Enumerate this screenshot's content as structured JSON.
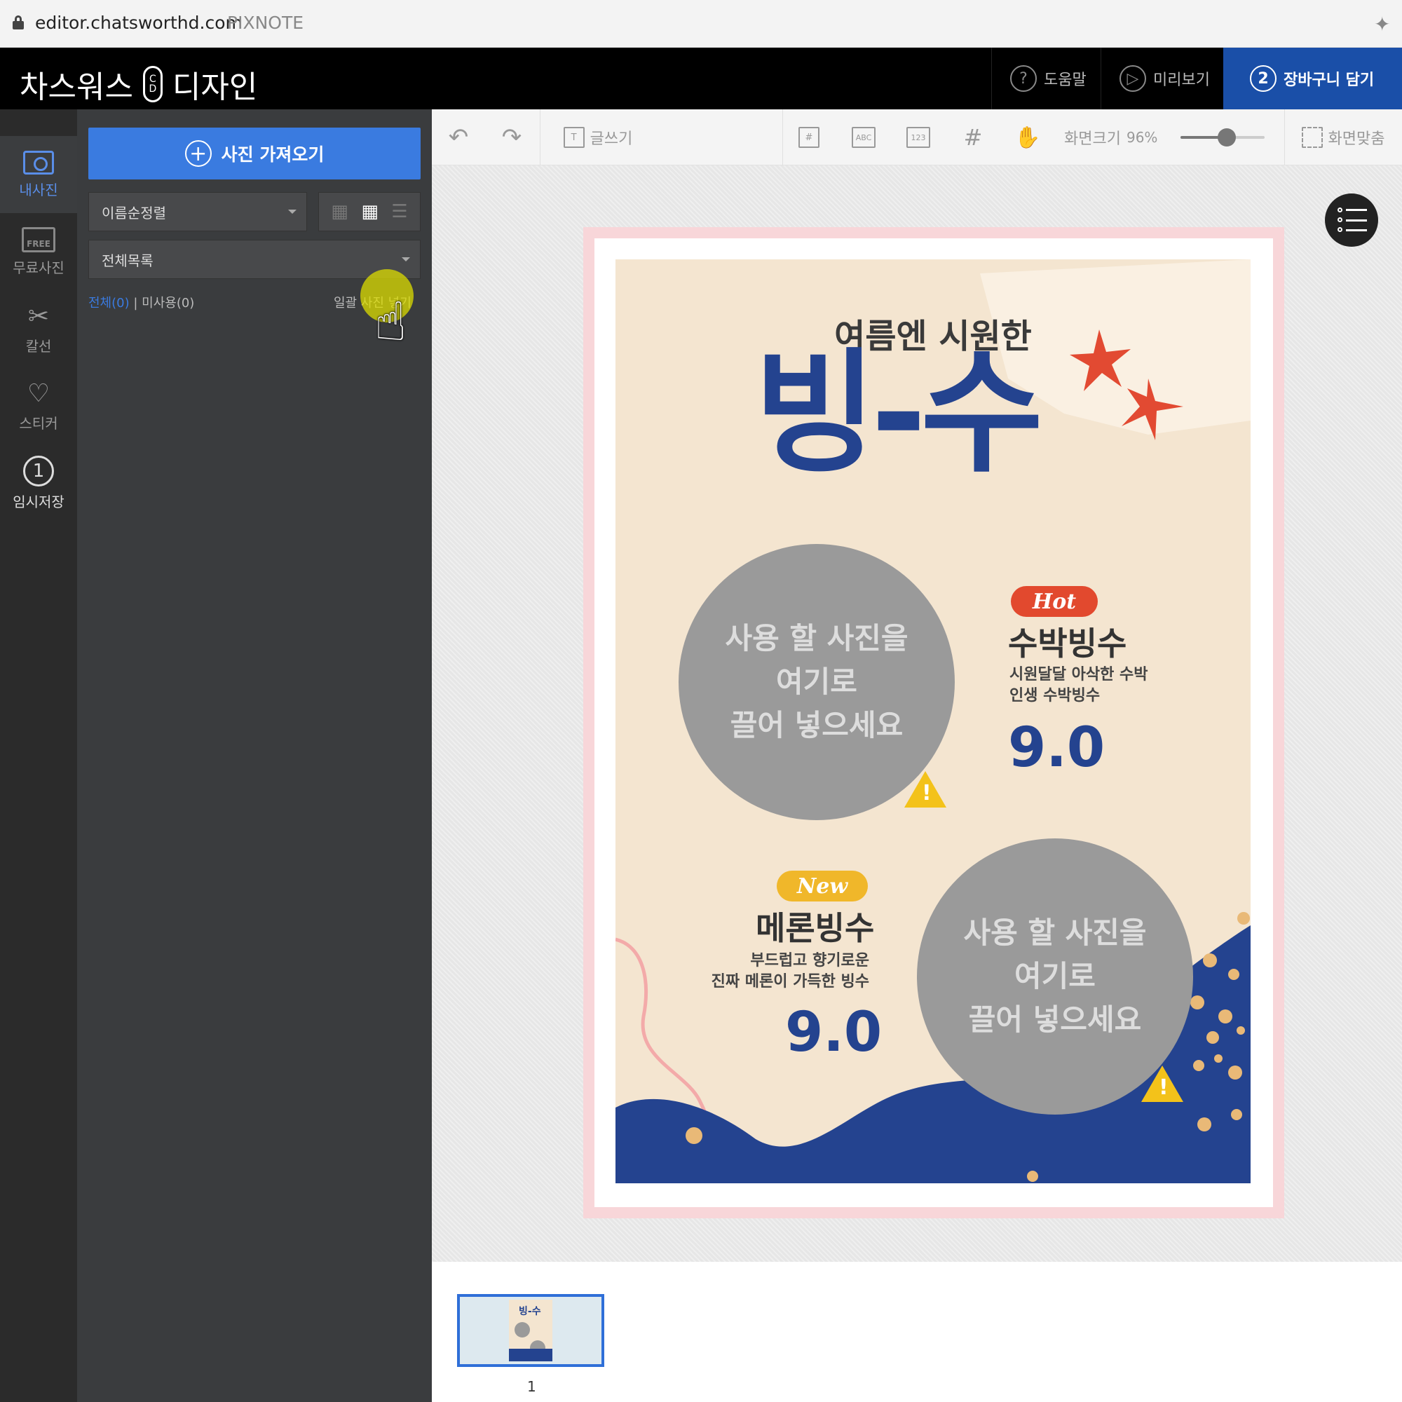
{
  "browser": {
    "domain": "editor.chatsworthd.com",
    "suffix": "PIXNOTE"
  },
  "app": {
    "brand_left": "차스워스",
    "brand_badge_top": "C",
    "brand_badge_bottom": "D",
    "brand_right": "디자인",
    "help_label": "도움말",
    "help_glyph": "?",
    "preview_label": "미리보기",
    "preview_glyph": "▷",
    "cart_label": "장바구니 담기",
    "cart_step": "2"
  },
  "rail": [
    {
      "label": "내사진",
      "active": true
    },
    {
      "label": "무료사진",
      "badge": "FREE"
    },
    {
      "label": "칼선",
      "glyph": "✂"
    },
    {
      "label": "스티커",
      "glyph": "♡"
    },
    {
      "label": "임시저장",
      "glyph": "1"
    }
  ],
  "panel": {
    "import_label": "사진 가져오기",
    "sort_value": "이름순정렬",
    "folder_value": "전체목록",
    "filter_all": "전체(0)",
    "filter_sep": " | ",
    "filter_unused": "미사용(0)",
    "bulk_label": "일괄 사진 넣기"
  },
  "toolbar": {
    "text_label": "글쓰기",
    "zoom_label": "화면크기",
    "zoom_value": "96%",
    "zoom_fraction": 0.55,
    "fit_label": "화면맞춤",
    "icon_page": "#",
    "icon_abc": "ABC",
    "icon_123": "123",
    "icon_grid": "#",
    "icon_hand": "✋"
  },
  "poster": {
    "subtitle": "여름엔 시원한",
    "title": "빙-수",
    "placeholder_text": "사용 할 사진을\n여기로\n끌어 넣으세요",
    "item1": {
      "tag": "Hot",
      "name": "수박빙수",
      "desc": "시원달달 아삭한 수박\n인생 수박빙수",
      "score": "9.0"
    },
    "item2": {
      "tag": "New",
      "name": "메론빙수",
      "desc": "부드럽고 향기로운\n진짜 메론이 가득한 빙수",
      "score": "9.0"
    },
    "colors": {
      "navy": "#24438f",
      "cream": "#f4e5d0",
      "red": "#e2492e",
      "yellow": "#f0b72a"
    }
  },
  "pages": {
    "current": "1"
  }
}
